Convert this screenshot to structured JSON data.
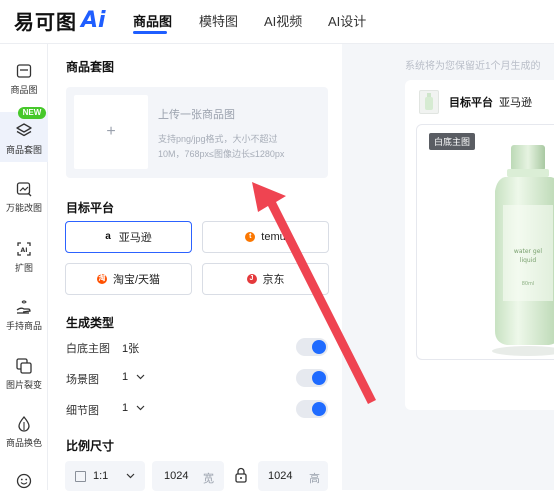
{
  "logo": {
    "cn": "易可图",
    "ai": "Ai"
  },
  "nav": {
    "tabs": [
      "商品图",
      "模特图",
      "AI视频",
      "AI设计"
    ],
    "active": "商品图"
  },
  "sidebar": {
    "items": [
      {
        "label": "商品图",
        "icon": "image-frame-icon"
      },
      {
        "label": "商品套图",
        "icon": "stack-layers-icon",
        "badge": "NEW",
        "active": true
      },
      {
        "label": "万能改图",
        "icon": "image-edit-icon"
      },
      {
        "label": "扩图",
        "icon": "expand-ai-icon"
      },
      {
        "label": "手持商品",
        "icon": "hand-hold-icon"
      },
      {
        "label": "图片裂变",
        "icon": "image-split-icon"
      },
      {
        "label": "商品换色",
        "icon": "color-drop-icon"
      },
      {
        "label": "",
        "icon": "smile-icon"
      }
    ]
  },
  "panel": {
    "product_section": "商品套图",
    "upload": {
      "title": "上传一张商品图",
      "hint1": "支持png/jpg格式，大小不超过",
      "hint2": "10M，768px≤图像边长≤1280px",
      "plus": "+"
    },
    "platform_section": "目标平台",
    "platforms": [
      {
        "label": "亚马逊",
        "mark": "a",
        "active": true
      },
      {
        "label": "temu",
        "mark": "t",
        "active": false
      },
      {
        "label": "淘宝/天猫",
        "mark": "淘",
        "active": false
      },
      {
        "label": "京东",
        "mark": "J",
        "active": false
      }
    ],
    "gen_section": "生成类型",
    "gen_types": [
      {
        "label": "白底主图",
        "count": "1张",
        "enabled": true
      },
      {
        "label": "场景图",
        "count": "1",
        "enabled": true
      },
      {
        "label": "细节图",
        "count": "1",
        "enabled": true
      }
    ],
    "ratio_section": "比例尺寸",
    "ratio": {
      "value": "1:1",
      "width": "1024",
      "width_unit": "宽",
      "height": "1024",
      "height_unit": "高"
    }
  },
  "preview": {
    "note": "系统将为您保留近1个月生成的",
    "platform_label": "目标平台",
    "platform_value": "亚马逊",
    "image_tag": "白底主图",
    "product_text": {
      "line1": "water gel",
      "line2": "liquid",
      "line3": "80ml"
    }
  },
  "colors": {
    "accent": "#1f5eff",
    "arrow": "#ef4451",
    "badge": "#46c82a"
  }
}
